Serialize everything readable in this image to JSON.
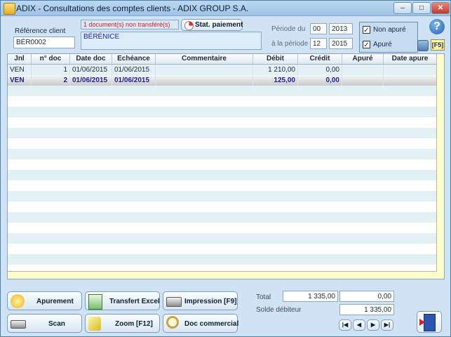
{
  "window": {
    "title": "ADIX - Consultations des comptes clients - ADIX GROUP S.A.",
    "min": "–",
    "max": "□",
    "close": "✕"
  },
  "header": {
    "ref_label": "Référence client",
    "ref_value": "BÉR0002",
    "notice": "1 document(s) non transféré(s)",
    "client_name": "BÉRÉNICE",
    "stat_button": "Stat. paiement",
    "period_from_label": "Période du",
    "period_from_month": "00",
    "period_from_year": "2013",
    "period_to_label": "à la période",
    "period_to_month": "12",
    "period_to_year": "2015",
    "check_non_apure": "Non apuré",
    "check_apure": "Apuré",
    "f5": "[F5]",
    "help": "?"
  },
  "grid": {
    "columns": [
      "Jnl",
      "n° doc",
      "Date doc",
      "Echéance",
      "Commentaire",
      "Débit",
      "Crédit",
      "Apuré",
      "Date apure"
    ],
    "rows": [
      [
        "VEN",
        "1",
        "01/06/2015",
        "01/06/2015",
        "",
        "1 210,00",
        "0,00",
        "",
        ""
      ],
      [
        "VEN",
        "2",
        "01/06/2015",
        "01/06/2015",
        "",
        "125,00",
        "0,00",
        "",
        ""
      ]
    ]
  },
  "buttons": {
    "apurement": "Apurement",
    "transfert_excel": "Transfert Excel",
    "impression": "Impression [F9]",
    "scan": "Scan",
    "zoom": "Zoom [F12]",
    "doc_commercial": "Doc commercial"
  },
  "totals": {
    "total_label": "Total",
    "total_debit": "1 335,00",
    "total_credit": "0,00",
    "solde_label": "Solde débiteur",
    "solde_value": "1 335,00"
  },
  "nav": {
    "first": "|◀",
    "prev": "◀",
    "next": "▶",
    "last": "▶|"
  },
  "colors": {
    "selected_text": "#1c1c9a",
    "notice": "#d02020",
    "accent": "#4a7fb0"
  }
}
